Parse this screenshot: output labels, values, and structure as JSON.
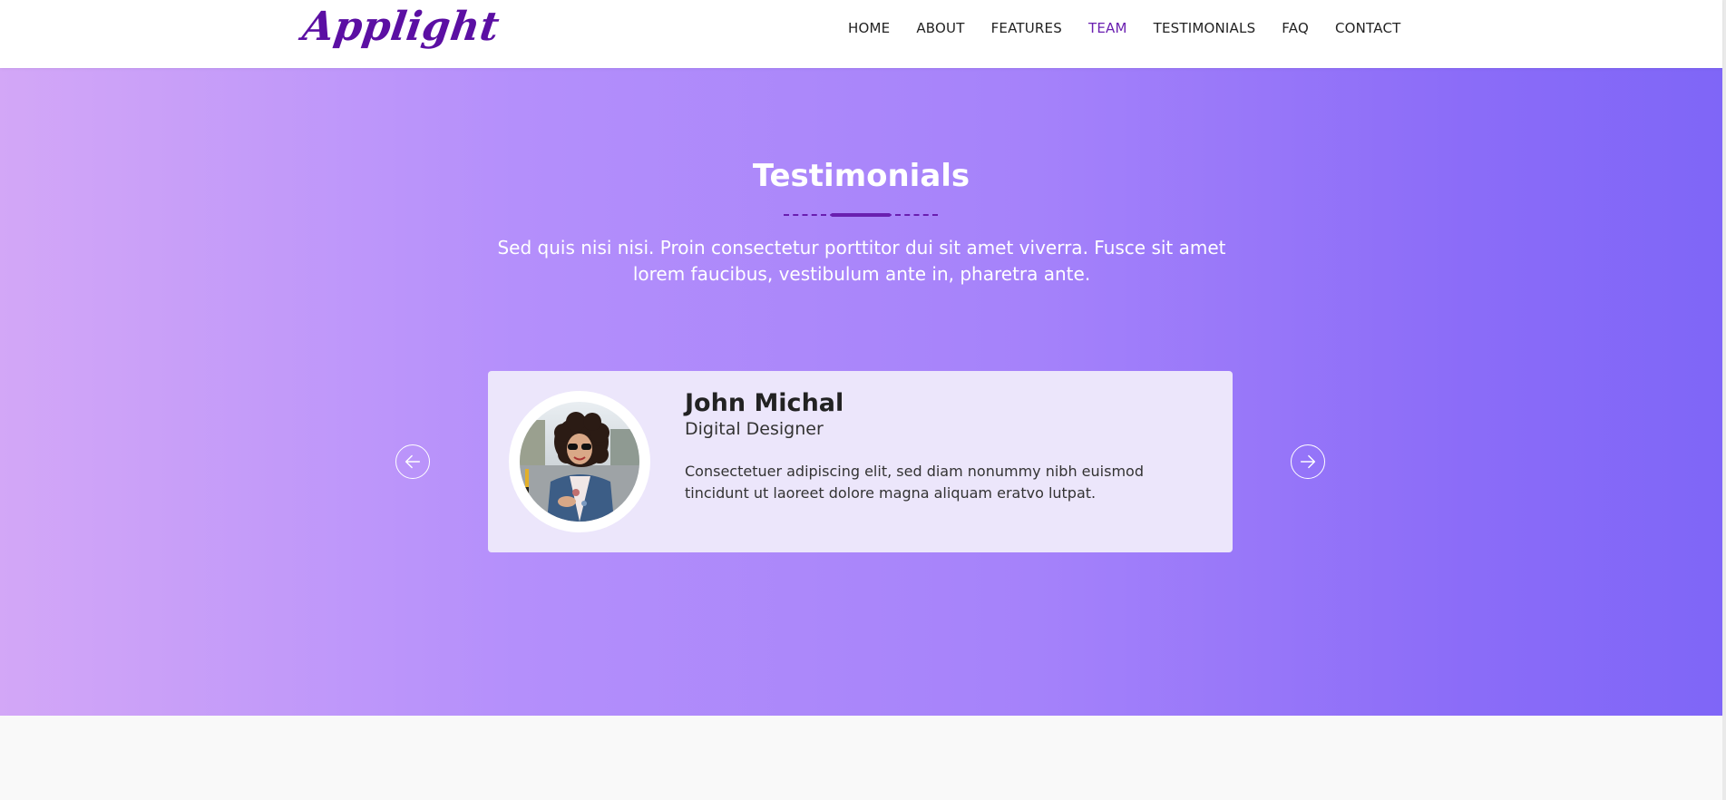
{
  "brand": {
    "logo_text": "Applight"
  },
  "nav": {
    "items": [
      {
        "label": "HOME"
      },
      {
        "label": "ABOUT"
      },
      {
        "label": "FEATURES"
      },
      {
        "label": "TEAM",
        "active": true
      },
      {
        "label": "TESTIMONIALS"
      },
      {
        "label": "FAQ"
      },
      {
        "label": "CONTACT"
      }
    ]
  },
  "section": {
    "title": "Testimonials",
    "subtitle": "Sed quis nisi nisi. Proin consectetur porttitor dui sit amet viverra. Fusce sit amet lorem faucibus, vestibulum ante in, pharetra ante."
  },
  "testimonial": {
    "name": "John Michal",
    "role": "Digital Designer",
    "quote": "Consectetuer adipiscing elit, sed diam nonummy nibh euismod tincidunt ut laoreet dolore magna aliquam eratvo lutpat."
  },
  "icons": {
    "prev": "arrow-left-circle-icon",
    "next": "arrow-right-circle-icon"
  },
  "colors": {
    "accent": "#6a1fb0",
    "gradient_start": "#d3a7f7",
    "gradient_end": "#7f66f7",
    "card_bg": "#ece6fb"
  }
}
